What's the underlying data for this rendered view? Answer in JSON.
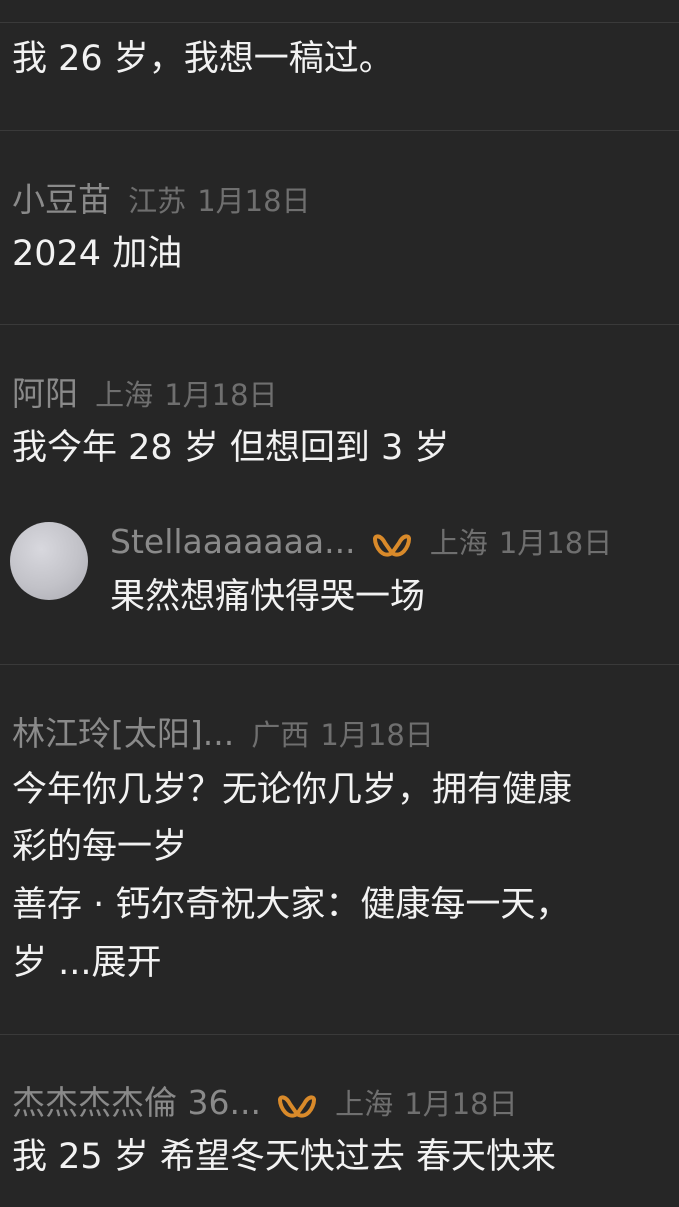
{
  "comments": [
    {
      "content_lines": [
        "我 26 岁，我想一稿过。"
      ]
    },
    {
      "author": "小豆苗",
      "location": "江苏",
      "date": "1月18日",
      "content_lines": [
        "2024 加油"
      ]
    },
    {
      "author": "阿阳",
      "location": "上海",
      "date": "1月18日",
      "content_lines": [
        "我今年 28 岁  但想回到 3 岁"
      ],
      "reply": {
        "author": "Stellaaaaaaa...",
        "badge_icon": "knot-badge-icon",
        "location": "上海",
        "date": "1月18日",
        "content": "果然想痛快得哭一场"
      }
    },
    {
      "author": "林江玲[太阳]...",
      "location": "广西",
      "date": "1月18日",
      "content_lines": [
        "今年你几岁？无论你几岁，拥有健康",
        "彩的每一岁",
        "善存 · 钙尔奇祝大家：健康每一天，"
      ],
      "last_line_text": "岁 ...",
      "expand_label": "展开"
    },
    {
      "author": "杰杰杰杰倫 36...",
      "badge_icon": "knot-badge-icon",
      "location": "上海",
      "date": "1月18日",
      "content_lines": [
        "我 25 岁  希望冬天快过去  春天快来"
      ]
    }
  ],
  "colors": {
    "background": "#262626",
    "author": "#8a8a8a",
    "meta": "#6f6f6f",
    "content": "#f2f2f2",
    "badge": "#d98a2a",
    "divider": "#3a3a3a"
  }
}
